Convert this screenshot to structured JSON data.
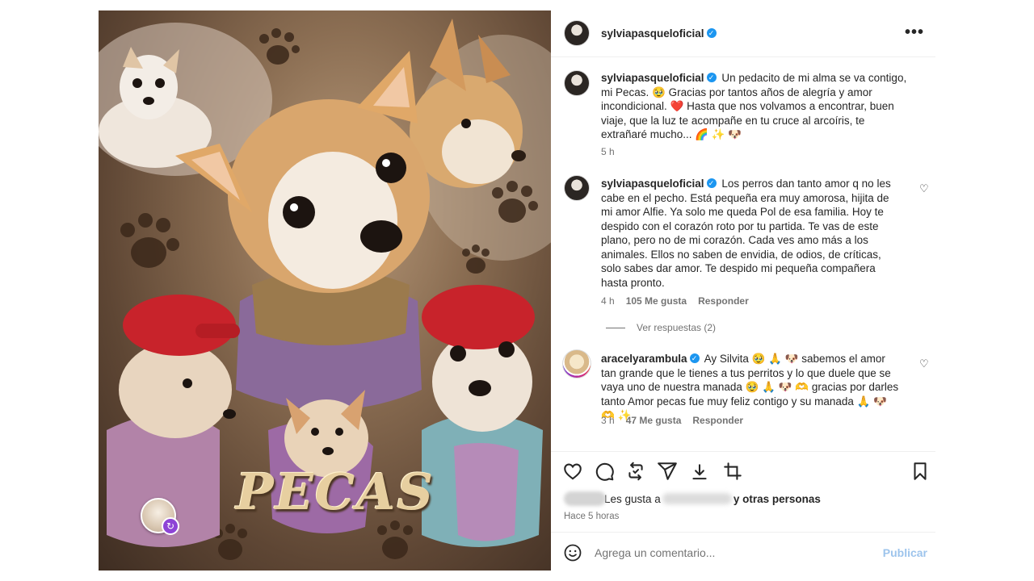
{
  "post": {
    "title_text": "PECAS",
    "author": "sylviapasqueloficial",
    "more_label": "•••",
    "caption": {
      "author": "sylviapasqueloficial",
      "text": "Un pedacito de mi alma se va contigo, mi Pecas. 🥹 Gracias por tantos años de alegría y amor incondicional. ❤️ Hasta que nos volvamos a encontrar, buen viaje, que la luz te acompañe en tu cruce al arcoíris, te extrañaré mucho... 🌈 ✨ 🐶",
      "time": "5 h"
    },
    "comments": [
      {
        "author": "sylviapasqueloficial",
        "text": "Los perros dan tanto amor q no les cabe en el pecho. Está pequeña era muy amorosa, hijita de mi amor Alfie. Ya solo me queda Pol de esa familia. Hoy te despido con el corazón roto por tu partida. Te vas de este plano, pero no de mi corazón. Cada ves amo más a los animales. Ellos no saben de envidia, de odios, de críticas, solo sabes dar amor. Te despido mi pequeña compañera hasta pronto.",
        "time": "4 h",
        "likes": "105 Me gusta",
        "reply": "Responder",
        "view_replies": "Ver respuestas (2)"
      },
      {
        "author": "aracelyarambula",
        "text": "Ay Silvita 🥹 🙏 🐶 sabemos el amor tan grande que le tienes a tus perritos y lo que duele que se vaya uno de nuestra manada 🥹 🙏 🐶 🫶 gracias por darles tanto Amor pecas fue muy feliz contigo y su manada 🙏 🐶 🫶 ✨",
        "time": "3 h",
        "likes": "47 Me gusta",
        "reply": "Responder"
      }
    ],
    "likes_prefix": "Les gusta a",
    "likes_suffix": "y otras personas",
    "posted_ago": "Hace 5 horas",
    "comment_placeholder": "Agrega un comentario...",
    "publish_label": "Publicar"
  },
  "colors": {
    "verified": "#1c96f0",
    "publish": "#9dc4ec",
    "meta": "#737373"
  },
  "icons": [
    "heart-icon",
    "comment-icon",
    "repost-icon",
    "share-icon",
    "download-icon",
    "crop-icon",
    "bookmark-icon",
    "emoji-icon",
    "verified-icon",
    "more-icon"
  ]
}
